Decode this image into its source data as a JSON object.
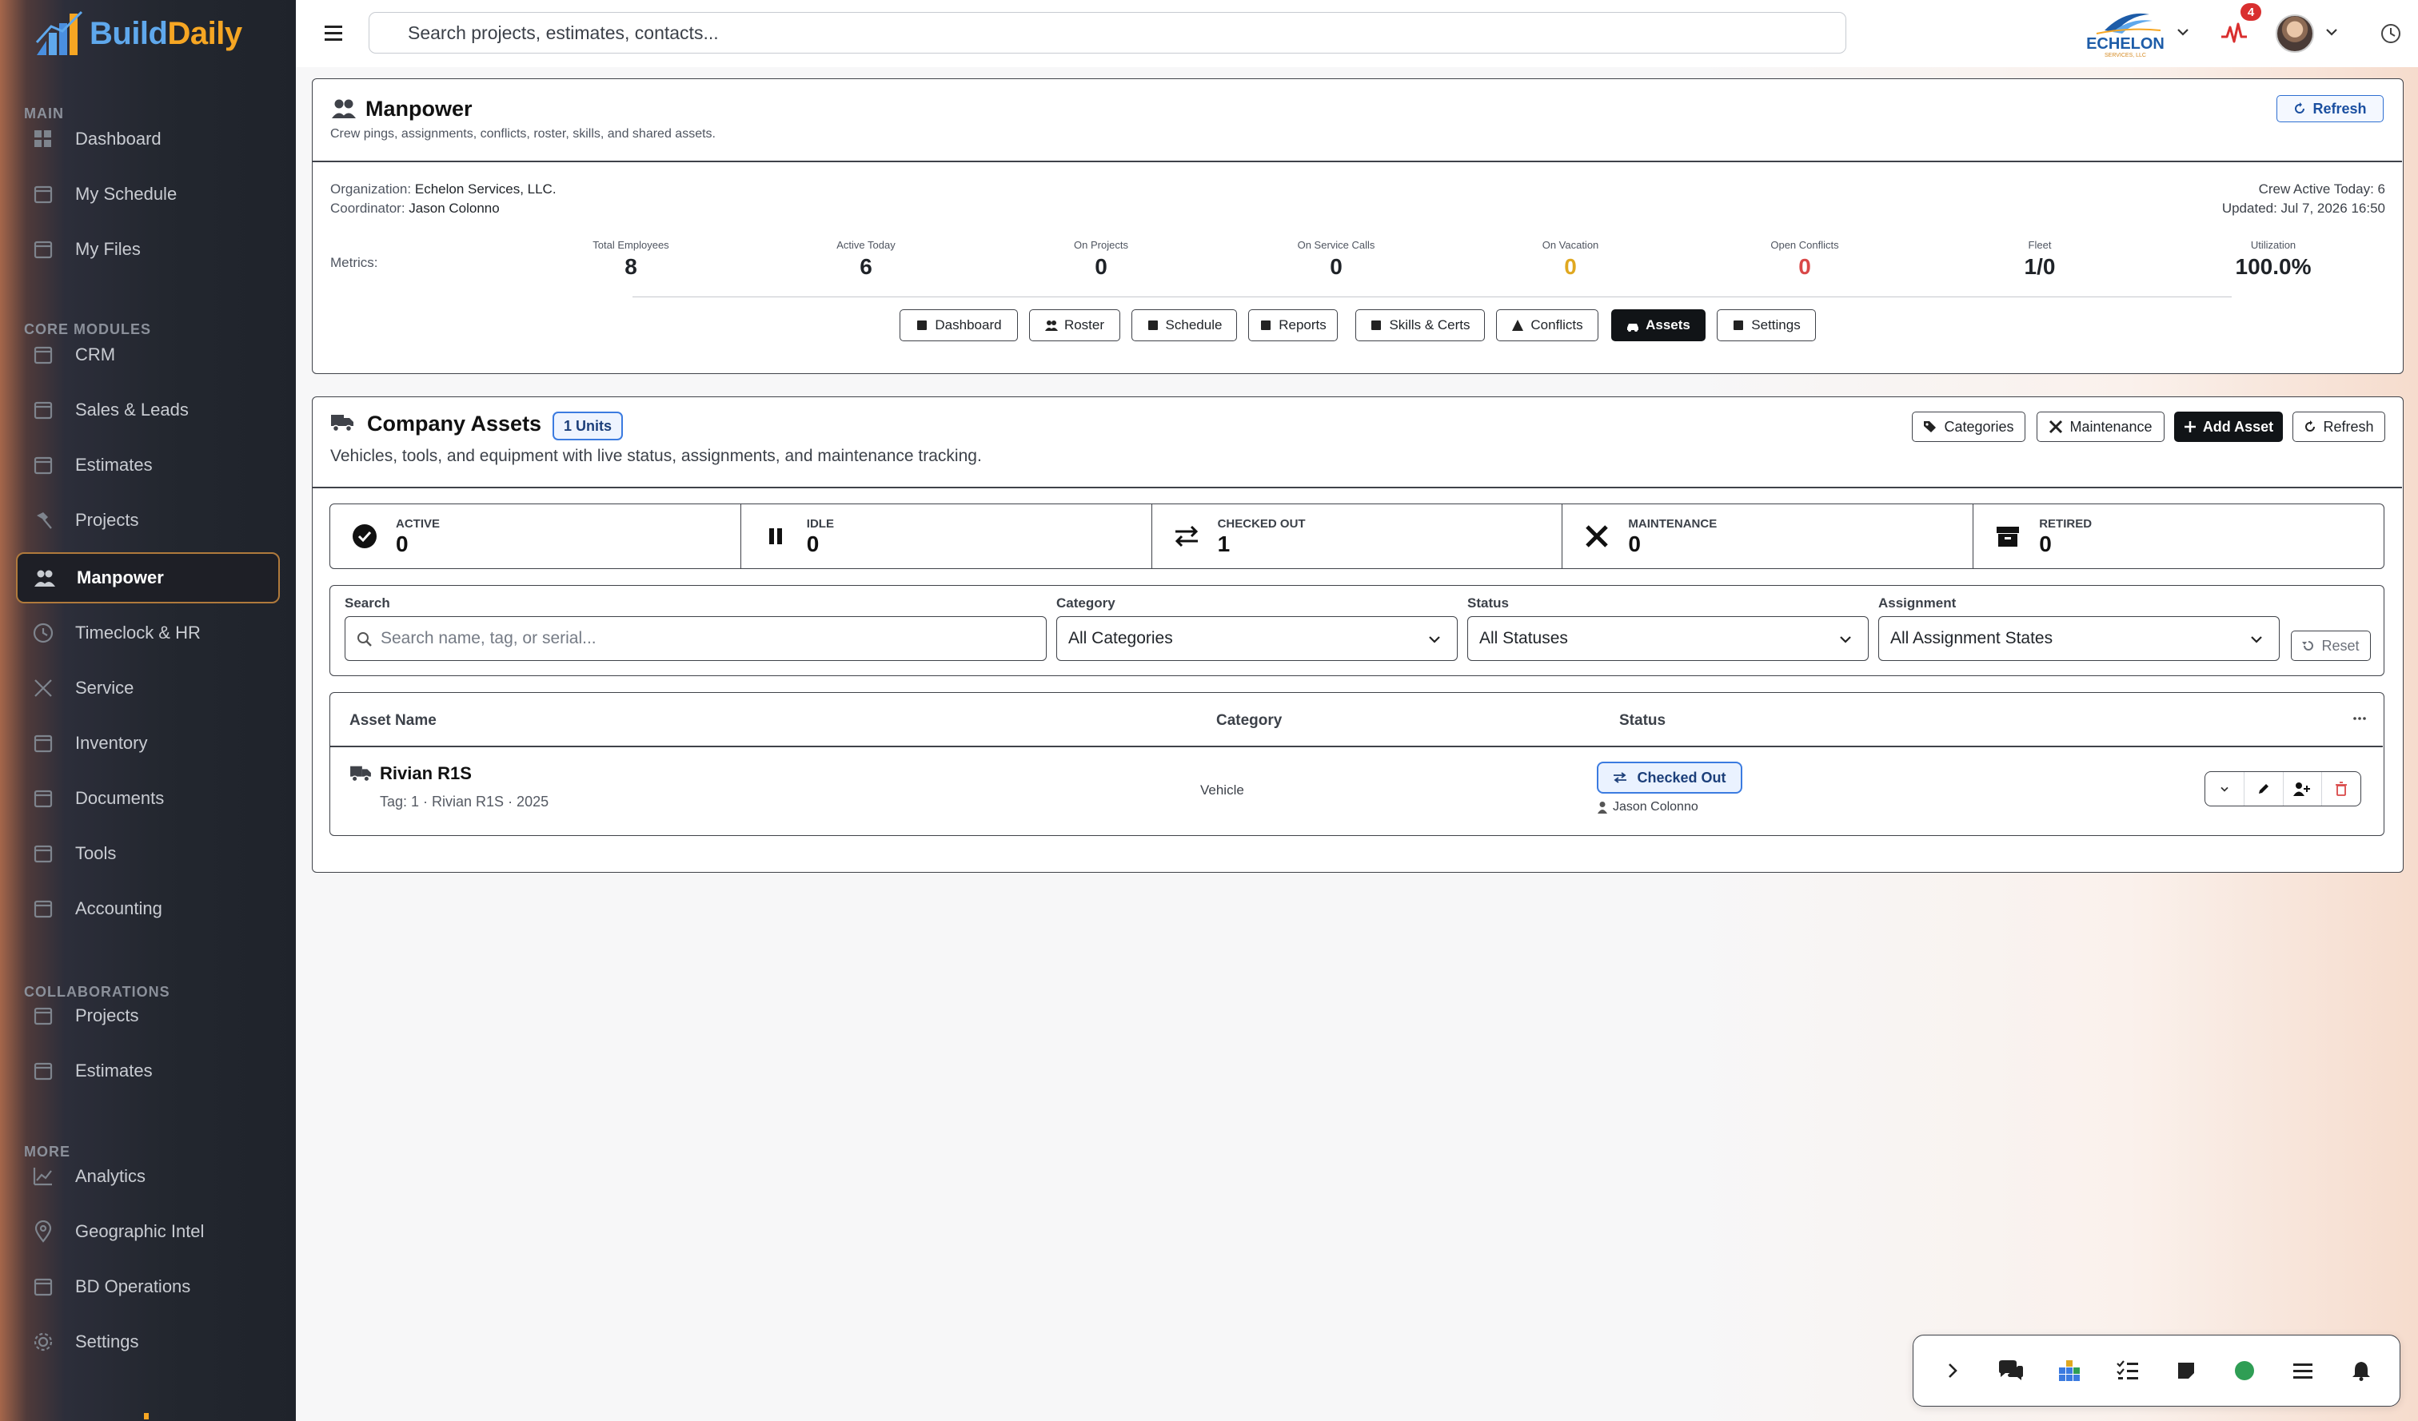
{
  "brand": {
    "build": "Build",
    "daily": "Daily"
  },
  "sidebar": {
    "sections": {
      "main": "MAIN",
      "core": "CORE MODULES",
      "collab": "COLLABORATIONS",
      "more": "MORE"
    },
    "items": [
      {
        "label": "Dashboard",
        "icon": "dashboard-icon"
      },
      {
        "label": "My Schedule",
        "icon": "calendar-icon"
      },
      {
        "label": "My Files",
        "icon": "folder-icon"
      },
      {
        "label": "CRM",
        "icon": "crm-icon"
      },
      {
        "label": "Sales & Leads",
        "icon": "briefcase-icon"
      },
      {
        "label": "Estimates",
        "icon": "calculator-icon"
      },
      {
        "label": "Projects",
        "icon": "hammer-icon"
      },
      {
        "label": "Manpower",
        "icon": "users-icon"
      },
      {
        "label": "Timeclock & HR",
        "icon": "clock-icon"
      },
      {
        "label": "Service",
        "icon": "wrench-icon"
      },
      {
        "label": "Inventory",
        "icon": "box-icon"
      },
      {
        "label": "Documents",
        "icon": "document-icon"
      },
      {
        "label": "Tools",
        "icon": "toolbox-icon"
      },
      {
        "label": "Accounting",
        "icon": "ledger-icon"
      },
      {
        "label": "Projects",
        "icon": "folder-shared-icon"
      },
      {
        "label": "Estimates",
        "icon": "estimate-edit-icon"
      },
      {
        "label": "Analytics",
        "icon": "chart-icon"
      },
      {
        "label": "Geographic Intel",
        "icon": "map-pin-icon"
      },
      {
        "label": "BD Operations",
        "icon": "building-icon"
      },
      {
        "label": "Settings",
        "icon": "gear-icon"
      }
    ]
  },
  "topbar": {
    "search_placeholder": "Search projects, estimates, contacts...",
    "org_logo": {
      "name": "ECHELON",
      "sub": "SERVICES, LLC"
    },
    "notification_count": "4"
  },
  "manpower": {
    "title": "Manpower",
    "subtitle": "Crew pings, assignments, conflicts, roster, skills, and shared assets.",
    "refresh_label": "Refresh",
    "org_label": "Organization:",
    "org_value": "Echelon Services, LLC.",
    "coord_label": "Coordinator:",
    "coord_value": "Jason Colonno",
    "crew_active": "Crew Active Today: 6",
    "updated": "Updated: Jul 7, 2026 16:50",
    "metrics_label": "Metrics:",
    "metrics": [
      {
        "label": "Total Employees",
        "value": "8",
        "color": "#1f2328"
      },
      {
        "label": "Active Today",
        "value": "6",
        "color": "#1f2328"
      },
      {
        "label": "On Projects",
        "value": "0",
        "color": "#1f2328"
      },
      {
        "label": "On Service Calls",
        "value": "0",
        "color": "#1f2328"
      },
      {
        "label": "On Vacation",
        "value": "0",
        "color": "#e0a820"
      },
      {
        "label": "Open Conflicts",
        "value": "0",
        "color": "#d94848"
      },
      {
        "label": "Fleet",
        "value": "1/0",
        "color": "#1f2328"
      },
      {
        "label": "Utilization",
        "value": "100.0%",
        "color": "#1f2328"
      }
    ],
    "tabs": [
      {
        "label": "Dashboard",
        "icon": "dashboard-tab-icon"
      },
      {
        "label": "Roster",
        "icon": "roster-icon"
      },
      {
        "label": "Schedule",
        "icon": "calendar-tab-icon"
      },
      {
        "label": "Reports",
        "icon": "reports-icon"
      },
      {
        "label": "Skills & Certs",
        "icon": "certificate-icon"
      },
      {
        "label": "Conflicts",
        "icon": "warning-icon"
      },
      {
        "label": "Assets",
        "icon": "car-icon"
      },
      {
        "label": "Settings",
        "icon": "gear-tab-icon"
      }
    ],
    "active_tab": "Assets"
  },
  "assets": {
    "title": "Company Assets",
    "units_badge": "1 Units",
    "subtitle": "Vehicles, tools, and equipment with live status, assignments, and maintenance tracking.",
    "buttons": {
      "categories": "Categories",
      "maintenance": "Maintenance",
      "add": "Add Asset",
      "refresh": "Refresh"
    },
    "stats": [
      {
        "label": "ACTIVE",
        "value": "0",
        "icon": "check-circle-icon"
      },
      {
        "label": "IDLE",
        "value": "0",
        "icon": "pause-icon"
      },
      {
        "label": "CHECKED OUT",
        "value": "1",
        "icon": "swap-icon"
      },
      {
        "label": "MAINTENANCE",
        "value": "0",
        "icon": "tools-icon"
      },
      {
        "label": "RETIRED",
        "value": "0",
        "icon": "archive-icon"
      }
    ],
    "filters": {
      "search_label": "Search",
      "search_placeholder": "Search name, tag, or serial...",
      "category_label": "Category",
      "category_value": "All Categories",
      "status_label": "Status",
      "status_value": "All Statuses",
      "assignment_label": "Assignment",
      "assignment_value": "All Assignment States",
      "reset": "Reset"
    },
    "table": {
      "headers": {
        "name": "Asset Name",
        "category": "Category",
        "status": "Status"
      },
      "rows": [
        {
          "name": "Rivian R1S",
          "meta": "Tag: 1 · Rivian R1S · 2025",
          "category": "Vehicle",
          "status": "Checked Out",
          "assignee": "Jason Colonno"
        }
      ]
    }
  },
  "colors": {
    "accent": "#f6a623",
    "brand_blue": "#5fa8ec",
    "status_blue": "#3b7be0",
    "danger": "#d94848",
    "warning": "#e0a820"
  }
}
